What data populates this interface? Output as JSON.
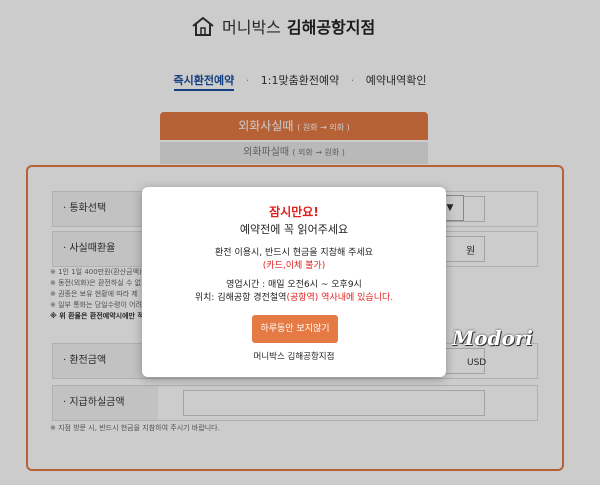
{
  "header": {
    "brand": "머니박스",
    "store": "김해공항지점"
  },
  "nav": {
    "items": [
      "즉시환전예약",
      "1:1맞춤환전예약",
      "예약내역확인"
    ]
  },
  "tabs": {
    "main": "외화사실때",
    "main_small": "( 원화 → 외화 )",
    "sub": "외화파실때",
    "sub_small": "( 외화 → 원화 )"
  },
  "form": {
    "currency_label": "· 통화선택",
    "rate_label": "· 사실때환율",
    "won_unit": "원",
    "notes": [
      "※ 1인 1일 400만원(환산금액)",
      "※ 동전(외화)은 환전하실 수 없",
      "※ 권종은 보유 현황에 따라 제",
      "※ 일부 통화는 당일수령이 어려",
      "※ 위 환율은 환전예약시에만 적"
    ],
    "amount_label": "· 환전금액",
    "usd_unit": "USD",
    "pay_label": "· 지급하실금액",
    "bottom_note": "※ 지점 방문 시, 반드시 현금을 지참하여 주시기 바랍니다."
  },
  "modal": {
    "title": "잠시만요!",
    "subtitle": "예약전에 꼭 읽어주세요",
    "line1": "환전 이용시, 반드시 현금을 지참해 주세요",
    "line2": "(카드,이체 불가)",
    "line3": "영업시간 : 매일 오전6시 ~ 오후9시",
    "line4_prefix": "위치: 김해공항 경전철역",
    "line4_red": "(공항역) 역사내에 있습니다.",
    "button": "하루동안 보지않기",
    "footer": "머니박스 김해공항지점"
  },
  "watermark": "Modori",
  "colors": {
    "accent": "#e57a44",
    "nav_active": "#1a4fa0",
    "alert": "#e0201e"
  }
}
